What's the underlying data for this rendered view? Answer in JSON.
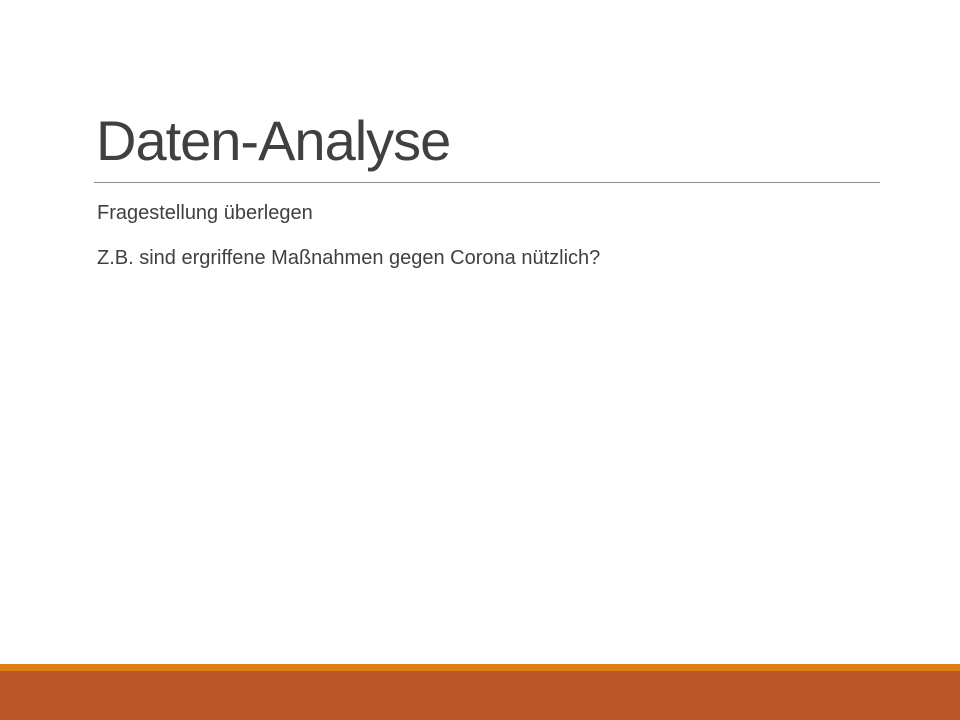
{
  "slide": {
    "title": "Daten-Analyse",
    "bullets": [
      "Fragestellung überlegen",
      "Z.B. sind ergriffene Maßnahmen gegen Corona nützlich?"
    ]
  },
  "colors": {
    "title_text": "#404040",
    "body_text": "#404040",
    "rule": "#8c8c8c",
    "footer_accent": "#e07e18",
    "footer_main": "#bc572b"
  }
}
